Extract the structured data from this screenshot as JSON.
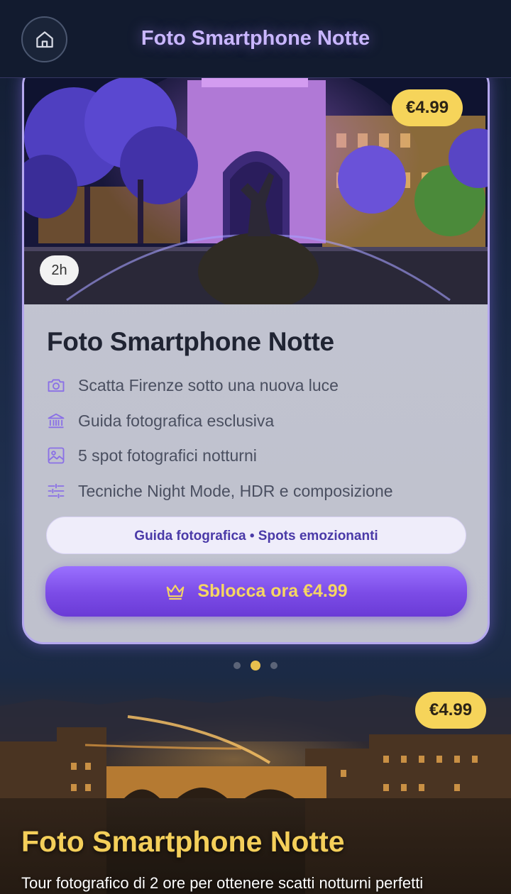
{
  "header": {
    "title": "Foto Smartphone Notte",
    "home_icon": "home-icon"
  },
  "card": {
    "price": "€4.99",
    "duration": "2h",
    "title": "Foto Smartphone Notte",
    "features": [
      {
        "icon": "camera-icon",
        "text": "Scatta Firenze sotto una nuova luce"
      },
      {
        "icon": "museum-icon",
        "text": "Guida fotografica esclusiva"
      },
      {
        "icon": "image-icon",
        "text": "5 spot fotografici notturni"
      },
      {
        "icon": "sliders-icon",
        "text": "Tecniche Night Mode, HDR e composizione"
      }
    ],
    "pill": "Guida fotografica • Spots emozionanti",
    "cta_label": "Sblocca ora €4.99",
    "cta_icon": "crown-icon"
  },
  "pagination": {
    "total": 3,
    "active": 2
  },
  "next_card": {
    "price": "€4.99",
    "title": "Foto Smartphone Notte",
    "description": "Tour fotografico di 2 ore per ottenere scatti notturni perfetti"
  },
  "colors": {
    "accent_purple": "#7b4be6",
    "gold": "#f6d45a",
    "header_title": "#c9b6ff"
  }
}
